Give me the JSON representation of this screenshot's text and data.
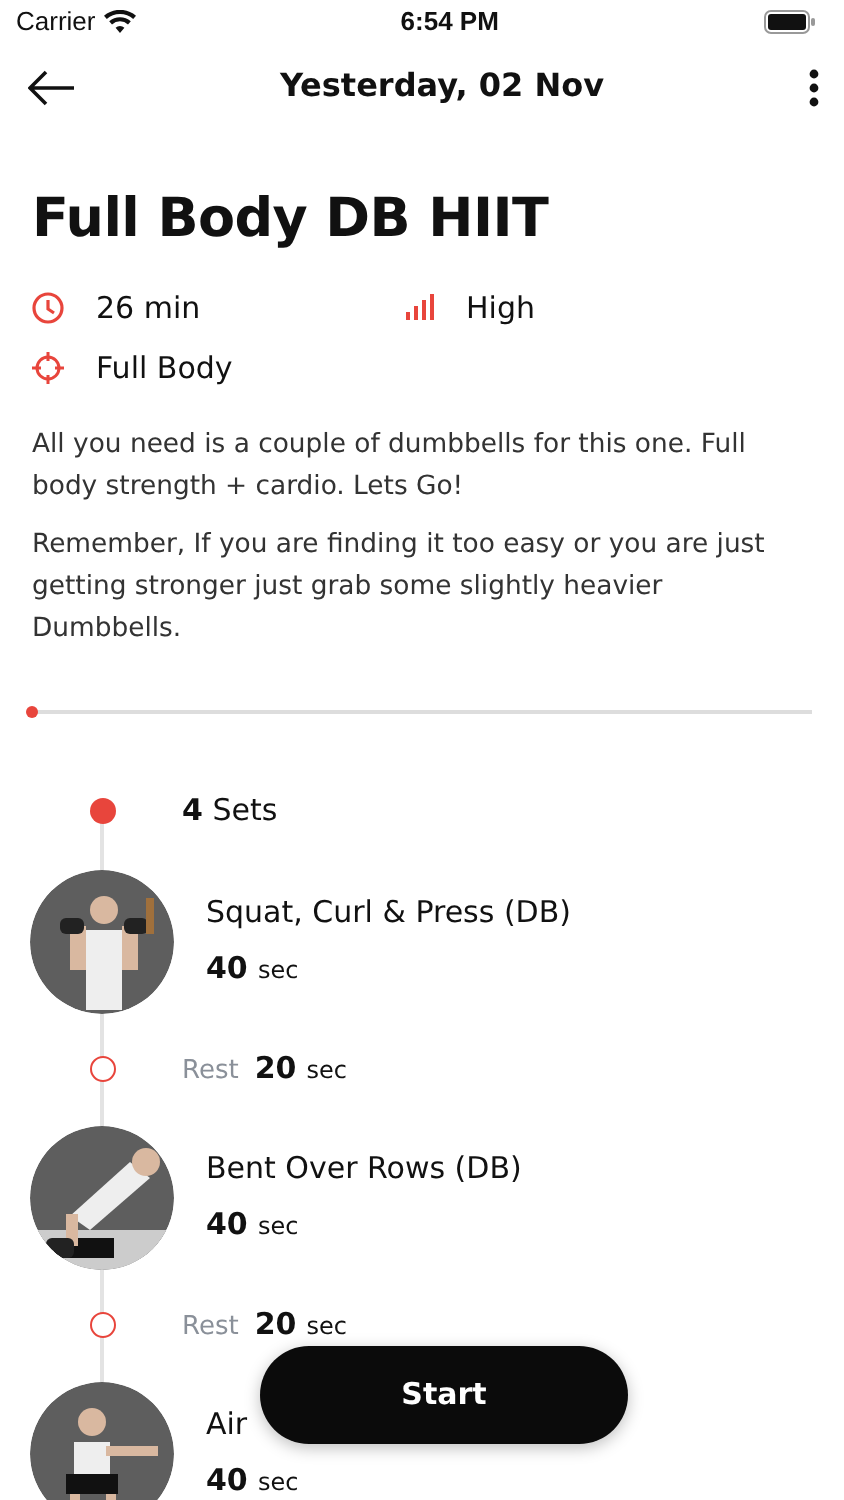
{
  "status_bar": {
    "carrier": "Carrier",
    "time": "6:54 PM"
  },
  "header": {
    "title": "Yesterday, 02 Nov"
  },
  "workout": {
    "title": "Full Body DB HIIT",
    "duration": "26 min",
    "intensity": "High",
    "focus": "Full Body",
    "description": [
      "All you need is a couple of dumbbells for this one. Full body strength + cardio. Lets Go!",
      "Remember, If you are finding it too easy or you are just getting stronger just grab some slightly heavier Dumbbells."
    ]
  },
  "progress": {
    "level": 0
  },
  "timeline": [
    {
      "kind": "set",
      "count": "4",
      "label": "Sets"
    },
    {
      "kind": "exercise",
      "name": "Squat, Curl & Press (DB)",
      "amount": "40",
      "unit": "sec"
    },
    {
      "kind": "rest",
      "label": "Rest",
      "amount": "20",
      "unit": "sec"
    },
    {
      "kind": "exercise",
      "name": "Bent Over Rows (DB)",
      "amount": "40",
      "unit": "sec"
    },
    {
      "kind": "rest",
      "label": "Rest",
      "amount": "20",
      "unit": "sec"
    },
    {
      "kind": "exercise",
      "name": "Air",
      "amount": "40",
      "unit": "sec"
    }
  ],
  "start_button": "Start"
}
